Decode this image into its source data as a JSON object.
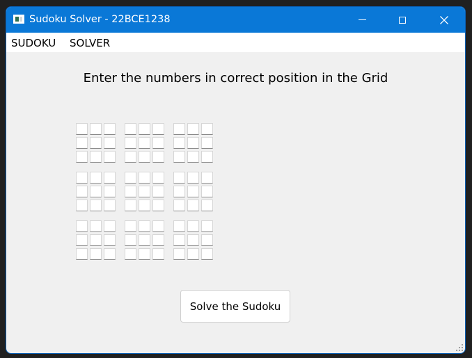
{
  "window": {
    "title": "Sudoku Solver - 22BCE1238",
    "accent_color": "#0a78d7",
    "icon": "app-window-icon"
  },
  "titlebar_buttons": {
    "minimize_icon": "minimize-icon",
    "maximize_icon": "maximize-icon",
    "close_icon": "close-icon",
    "close_glyph": "✕"
  },
  "menubar": {
    "items": [
      {
        "label": "SUDOKU"
      },
      {
        "label": "SOLVER"
      }
    ]
  },
  "main": {
    "heading": "Enter the numbers in correct position in the Grid",
    "grid": {
      "rows": 9,
      "cols": 9,
      "values": [
        [
          "",
          "",
          "",
          "",
          "",
          "",
          "",
          "",
          ""
        ],
        [
          "",
          "",
          "",
          "",
          "",
          "",
          "",
          "",
          ""
        ],
        [
          "",
          "",
          "",
          "",
          "",
          "",
          "",
          "",
          ""
        ],
        [
          "",
          "",
          "",
          "",
          "",
          "",
          "",
          "",
          ""
        ],
        [
          "",
          "",
          "",
          "",
          "",
          "",
          "",
          "",
          ""
        ],
        [
          "",
          "",
          "",
          "",
          "",
          "",
          "",
          "",
          ""
        ],
        [
          "",
          "",
          "",
          "",
          "",
          "",
          "",
          "",
          ""
        ],
        [
          "",
          "",
          "",
          "",
          "",
          "",
          "",
          "",
          ""
        ],
        [
          "",
          "",
          "",
          "",
          "",
          "",
          "",
          "",
          ""
        ]
      ]
    },
    "solve_button_label": "Solve the Sudoku"
  }
}
